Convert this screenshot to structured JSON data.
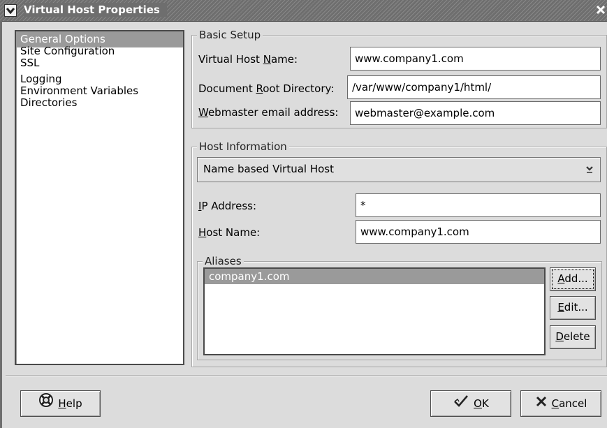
{
  "window": {
    "title": "Virtual Host Properties"
  },
  "sidebar": {
    "items": [
      {
        "label": "General Options",
        "selected": true
      },
      {
        "label": "Site Configuration",
        "selected": false
      },
      {
        "label": "SSL",
        "selected": false
      },
      {
        "label": "Logging",
        "selected": false
      },
      {
        "label": "Environment Variables",
        "selected": false
      },
      {
        "label": "Directories",
        "selected": false
      }
    ]
  },
  "basic_setup": {
    "legend": "Basic Setup",
    "vhost_name": {
      "label_pre": "Virtual Host ",
      "label_key": "N",
      "label_post": "ame:",
      "value": "www.company1.com"
    },
    "doc_root": {
      "label_pre": "Document ",
      "label_key": "R",
      "label_post": "oot Directory:",
      "value": "/var/www/company1/html/"
    },
    "webmaster": {
      "label_pre": "",
      "label_key": "W",
      "label_post": "ebmaster email address:",
      "value": "webmaster@example.com"
    }
  },
  "host_info": {
    "legend": "Host Information",
    "type_selected": "Name based Virtual Host",
    "ip": {
      "label_pre": "",
      "label_key": "I",
      "label_post": "P Address:",
      "value": "*"
    },
    "hostname": {
      "label_pre": "",
      "label_key": "H",
      "label_post": "ost Name:",
      "value": "www.company1.com"
    }
  },
  "aliases": {
    "legend": "Aliases",
    "items": [
      "company1.com"
    ],
    "add": {
      "key": "A",
      "rest": "dd..."
    },
    "edit": {
      "key": "E",
      "rest": "dit..."
    },
    "delete": {
      "key": "D",
      "rest": "elete"
    }
  },
  "footer": {
    "help": {
      "key": "H",
      "rest": "elp",
      "icon": "lifebuoy-icon"
    },
    "ok": {
      "key": "O",
      "rest": "K",
      "icon": "checkmark-icon"
    },
    "cancel": {
      "key": "C",
      "rest": "ancel",
      "icon": "x-icon"
    }
  },
  "colors": {
    "selection": "#9a9a9a",
    "titlebar": "#6e6e6e",
    "background": "#dcdcdc"
  }
}
